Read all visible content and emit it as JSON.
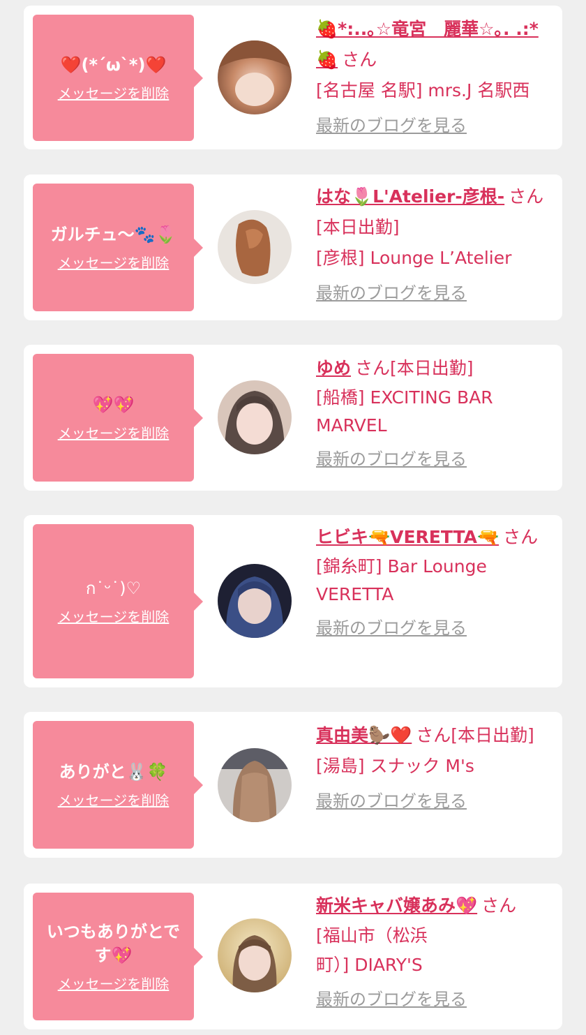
{
  "cards": [
    {
      "message": "❤️(*´ω`*)❤️",
      "delete_label": "メッセージを削除",
      "name": "🍓*:..｡☆竜宮　麗華☆｡. .:*🍓",
      "san": "さん",
      "status": "",
      "shop": "[名古屋 名駅] mrs.J 名駅西",
      "blog_label": "最新のブログを見る"
    },
    {
      "message": "ガルチュ〜🐾🌷",
      "delete_label": "メッセージを削除",
      "name": "はな🌷L'Atelier-彦根-",
      "san": "さん",
      "status": "[本日出勤]",
      "shop": "[彦根] Lounge L’Atelier",
      "blog_label": "最新のブログを見る"
    },
    {
      "message": "💖💖",
      "delete_label": "メッセージを削除",
      "name": "ゆめ",
      "san": "さん",
      "status": "[本日出勤]",
      "shop": "[船橋] EXCITING BAR MARVEL",
      "blog_label": "最新のブログを見る"
    },
    {
      "message": "ก˙ᵕ˙)♡",
      "delete_label": "メッセージを削除",
      "name": "ヒビキ🔫VERETTA🔫",
      "san": "さん",
      "status": "",
      "shop": "[錦糸町] Bar Lounge VERETTA",
      "blog_label": "最新のブログを見る"
    },
    {
      "message": "ありがと🐰🍀",
      "delete_label": "メッセージを削除",
      "name": "真由美🦫❤️",
      "san": "さん",
      "status": "[本日出勤]",
      "shop": "[湯島] スナック M's",
      "blog_label": "最新のブログを見る"
    },
    {
      "message": "いつもありがとです💖",
      "delete_label": "メッセージを削除",
      "name": "新米キャバ嬢あみ💖",
      "san": "さん",
      "status": "",
      "shop": "[福山市（松浜町）] DIARY'S",
      "blog_label": "最新のブログを見る"
    }
  ],
  "colors": {
    "page_bg": "#efefef",
    "bubble": "#f68a9b",
    "name": "#d8315b",
    "link_gray": "#9b9b9b"
  }
}
